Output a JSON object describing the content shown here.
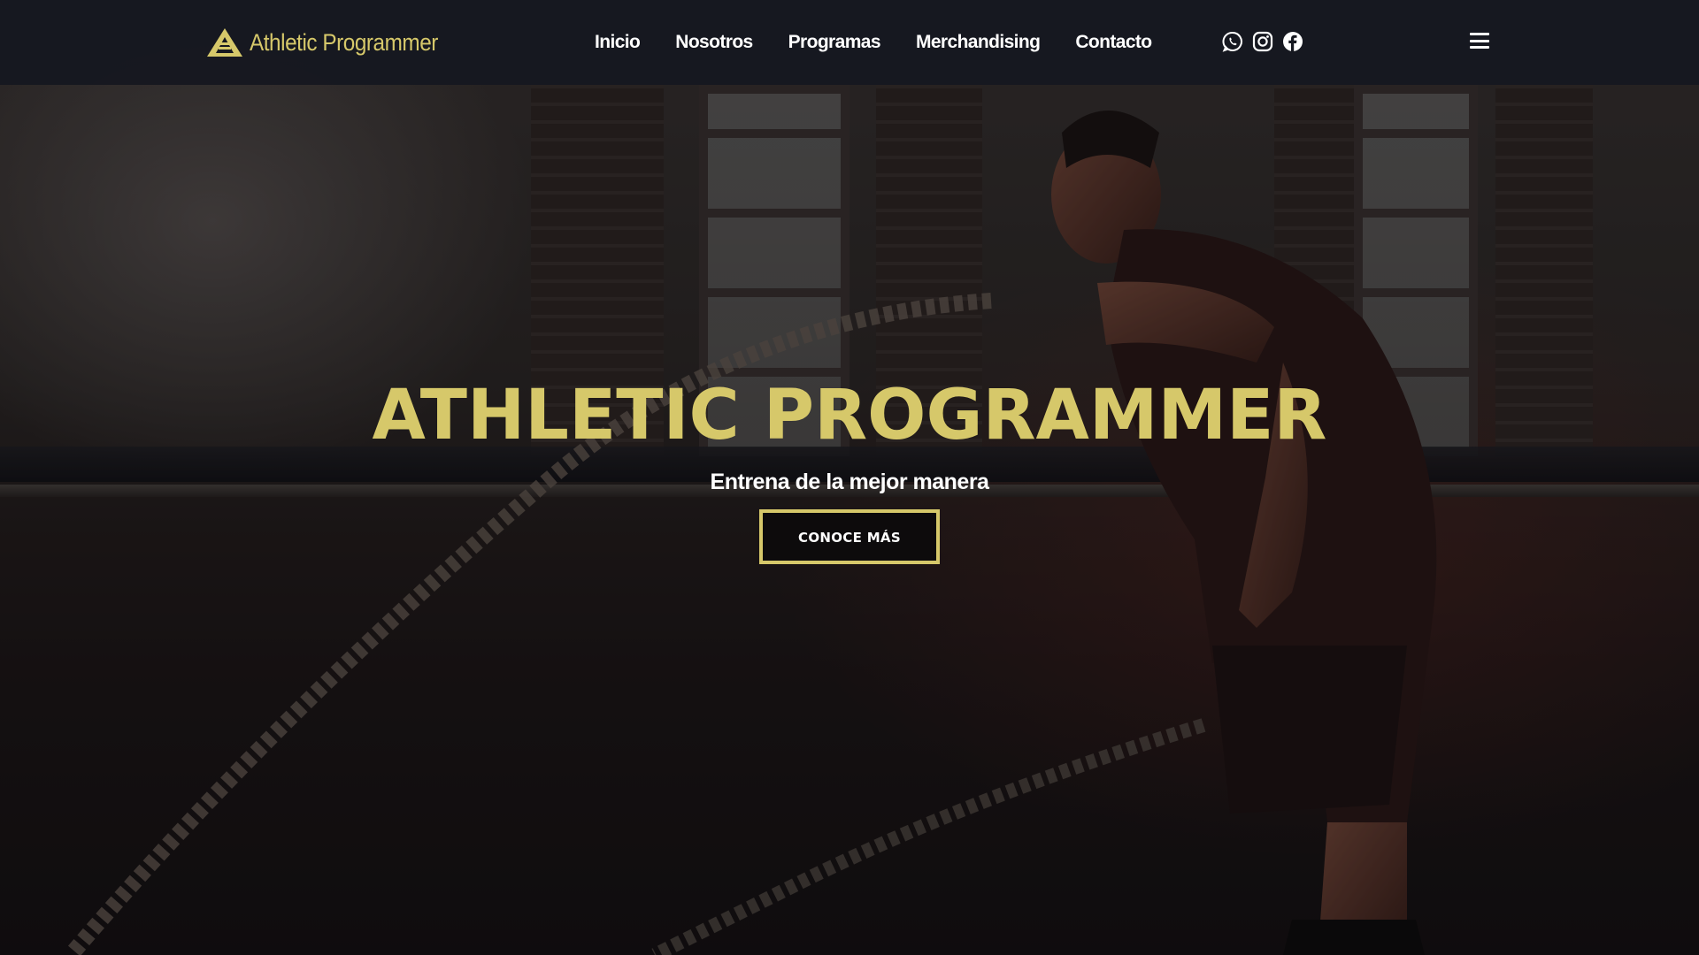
{
  "header": {
    "brand_name": "Athletic Programmer",
    "nav": [
      {
        "label": "Inicio"
      },
      {
        "label": "Nosotros"
      },
      {
        "label": "Programas"
      },
      {
        "label": "Merchandising"
      },
      {
        "label": "Contacto"
      }
    ],
    "socials": [
      "whatsapp-icon",
      "instagram-icon",
      "facebook-icon"
    ],
    "menu_icon": "hamburger-menu-icon"
  },
  "hero": {
    "title": "ATHLETIC PROGRAMMER",
    "subtitle": "Entrena de la mejor manera",
    "cta_label": "CONOCE MÁS"
  },
  "colors": {
    "accent": "#d6c86a",
    "header_bg": "#161820",
    "text": "#ffffff",
    "button_bg": "#0d0b0c"
  }
}
